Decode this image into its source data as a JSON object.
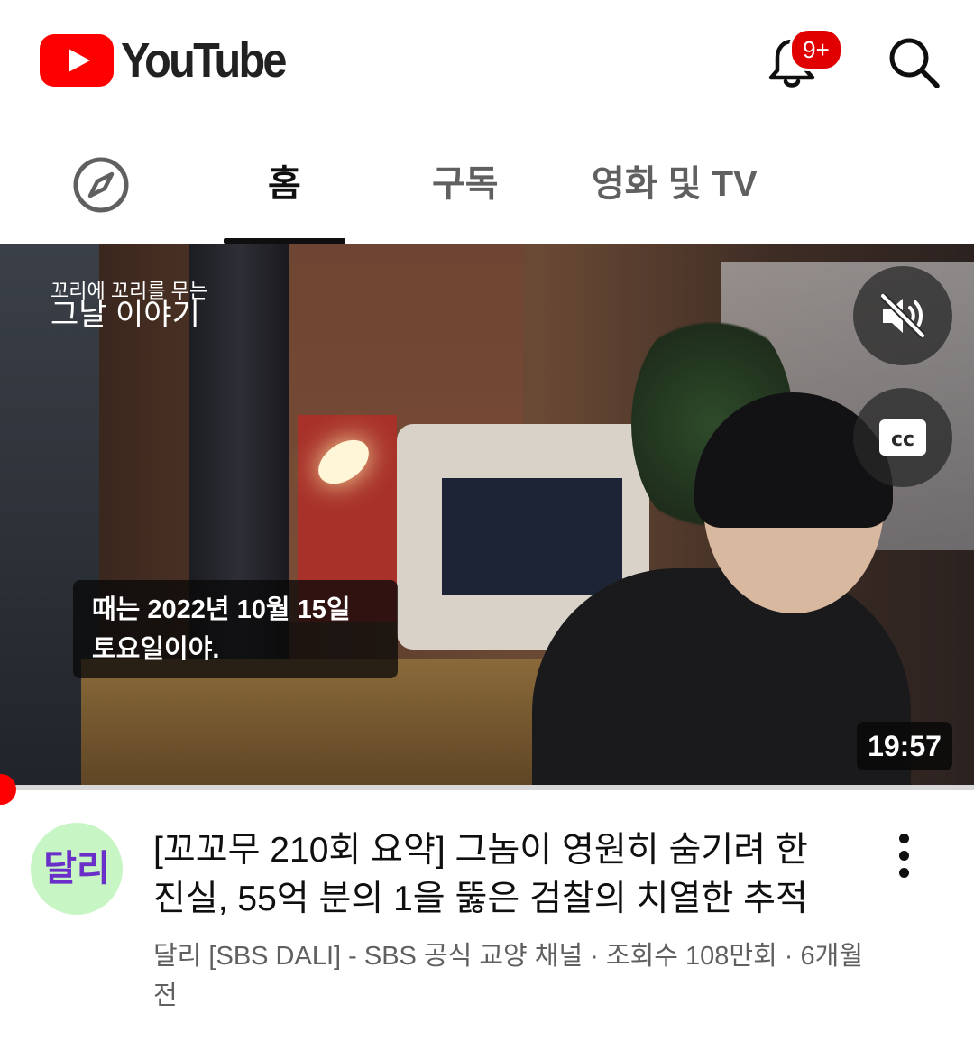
{
  "header": {
    "logo_text": "YouTube",
    "notification_badge": "9+",
    "brand_color": "#ff0000"
  },
  "tabs": [
    {
      "label": "홈",
      "active": true
    },
    {
      "label": "구독",
      "active": false
    },
    {
      "label": "영화 및 TV",
      "active": false
    }
  ],
  "icons": {
    "explore": "compass-icon",
    "notifications": "bell-icon",
    "search": "search-icon",
    "mute": "muted-speaker-icon",
    "captions": "closed-captions-icon",
    "more": "more-vertical-icon"
  },
  "video": {
    "caption_line1": "때는 2022년 10월 15일",
    "caption_line2": "토요일이야.",
    "duration": "19:57",
    "progress_fraction": 0.0,
    "show_logo_line1": "꼬리에 꼬리를 무는",
    "show_logo_line2": "그날 이야기",
    "cc_label": "cc"
  },
  "item": {
    "channel_avatar_text": "달리",
    "title": "[꼬꼬무 210회 요약] 그놈이 영원히 숨기려 한 진실, 55억 분의 1을 뚫은 검찰의 치열한 추적",
    "meta": "달리 [SBS DALI] - SBS 공식 교양 채널 · 조회수 108만회 · 6개월 전"
  }
}
